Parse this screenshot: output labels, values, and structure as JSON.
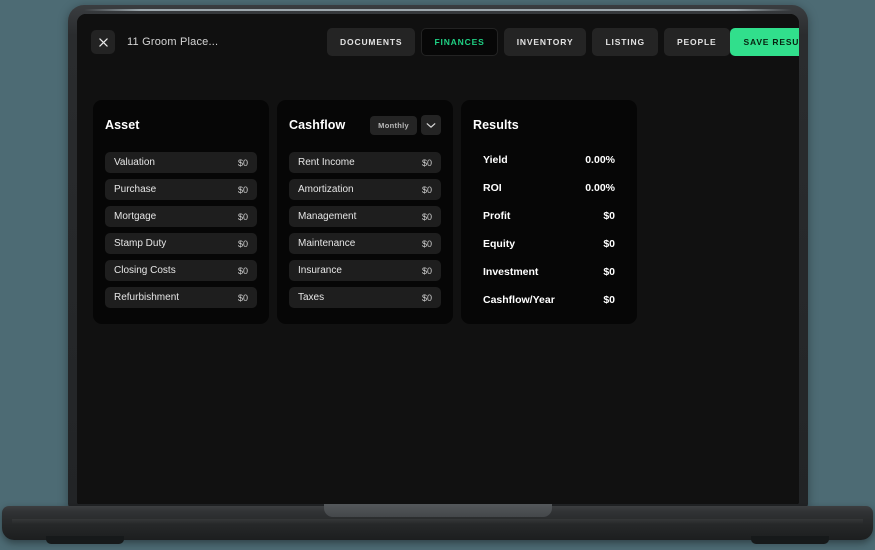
{
  "header": {
    "close_icon": "close-icon",
    "document_title": "11 Groom Place...",
    "tabs": [
      {
        "label": "DOCUMENTS",
        "active": false
      },
      {
        "label": "FINANCES",
        "active": true
      },
      {
        "label": "INVENTORY",
        "active": false
      },
      {
        "label": "LISTING",
        "active": false
      },
      {
        "label": "PEOPLE",
        "active": false
      }
    ],
    "save_label": "SAVE RESULTS & GENERATE PDF"
  },
  "colors": {
    "accent_green": "#31df8c",
    "active_tab_text": "#1fd184",
    "desktop_background": "#4d6b74",
    "card_background": "#060606",
    "row_background": "#1e1e1e"
  },
  "asset": {
    "title": "Asset",
    "rows": [
      {
        "label": "Valuation",
        "value": "$0"
      },
      {
        "label": "Purchase",
        "value": "$0"
      },
      {
        "label": "Mortgage",
        "value": "$0"
      },
      {
        "label": "Stamp Duty",
        "value": "$0"
      },
      {
        "label": "Closing Costs",
        "value": "$0"
      },
      {
        "label": "Refurbishment",
        "value": "$0"
      }
    ]
  },
  "cashflow": {
    "title": "Cashflow",
    "period_selected": "Monthly",
    "chevron_icon": "chevron-down-icon",
    "rows": [
      {
        "label": "Rent Income",
        "value": "$0"
      },
      {
        "label": "Amortization",
        "value": "$0"
      },
      {
        "label": "Management",
        "value": "$0"
      },
      {
        "label": "Maintenance",
        "value": "$0"
      },
      {
        "label": "Insurance",
        "value": "$0"
      },
      {
        "label": "Taxes",
        "value": "$0"
      }
    ]
  },
  "results": {
    "title": "Results",
    "rows": [
      {
        "label": "Yield",
        "value": "0.00%"
      },
      {
        "label": "ROI",
        "value": "0.00%"
      },
      {
        "label": "Profit",
        "value": "$0"
      },
      {
        "label": "Equity",
        "value": "$0"
      },
      {
        "label": "Investment",
        "value": "$0"
      },
      {
        "label": "Cashflow/Year",
        "value": "$0"
      }
    ]
  }
}
